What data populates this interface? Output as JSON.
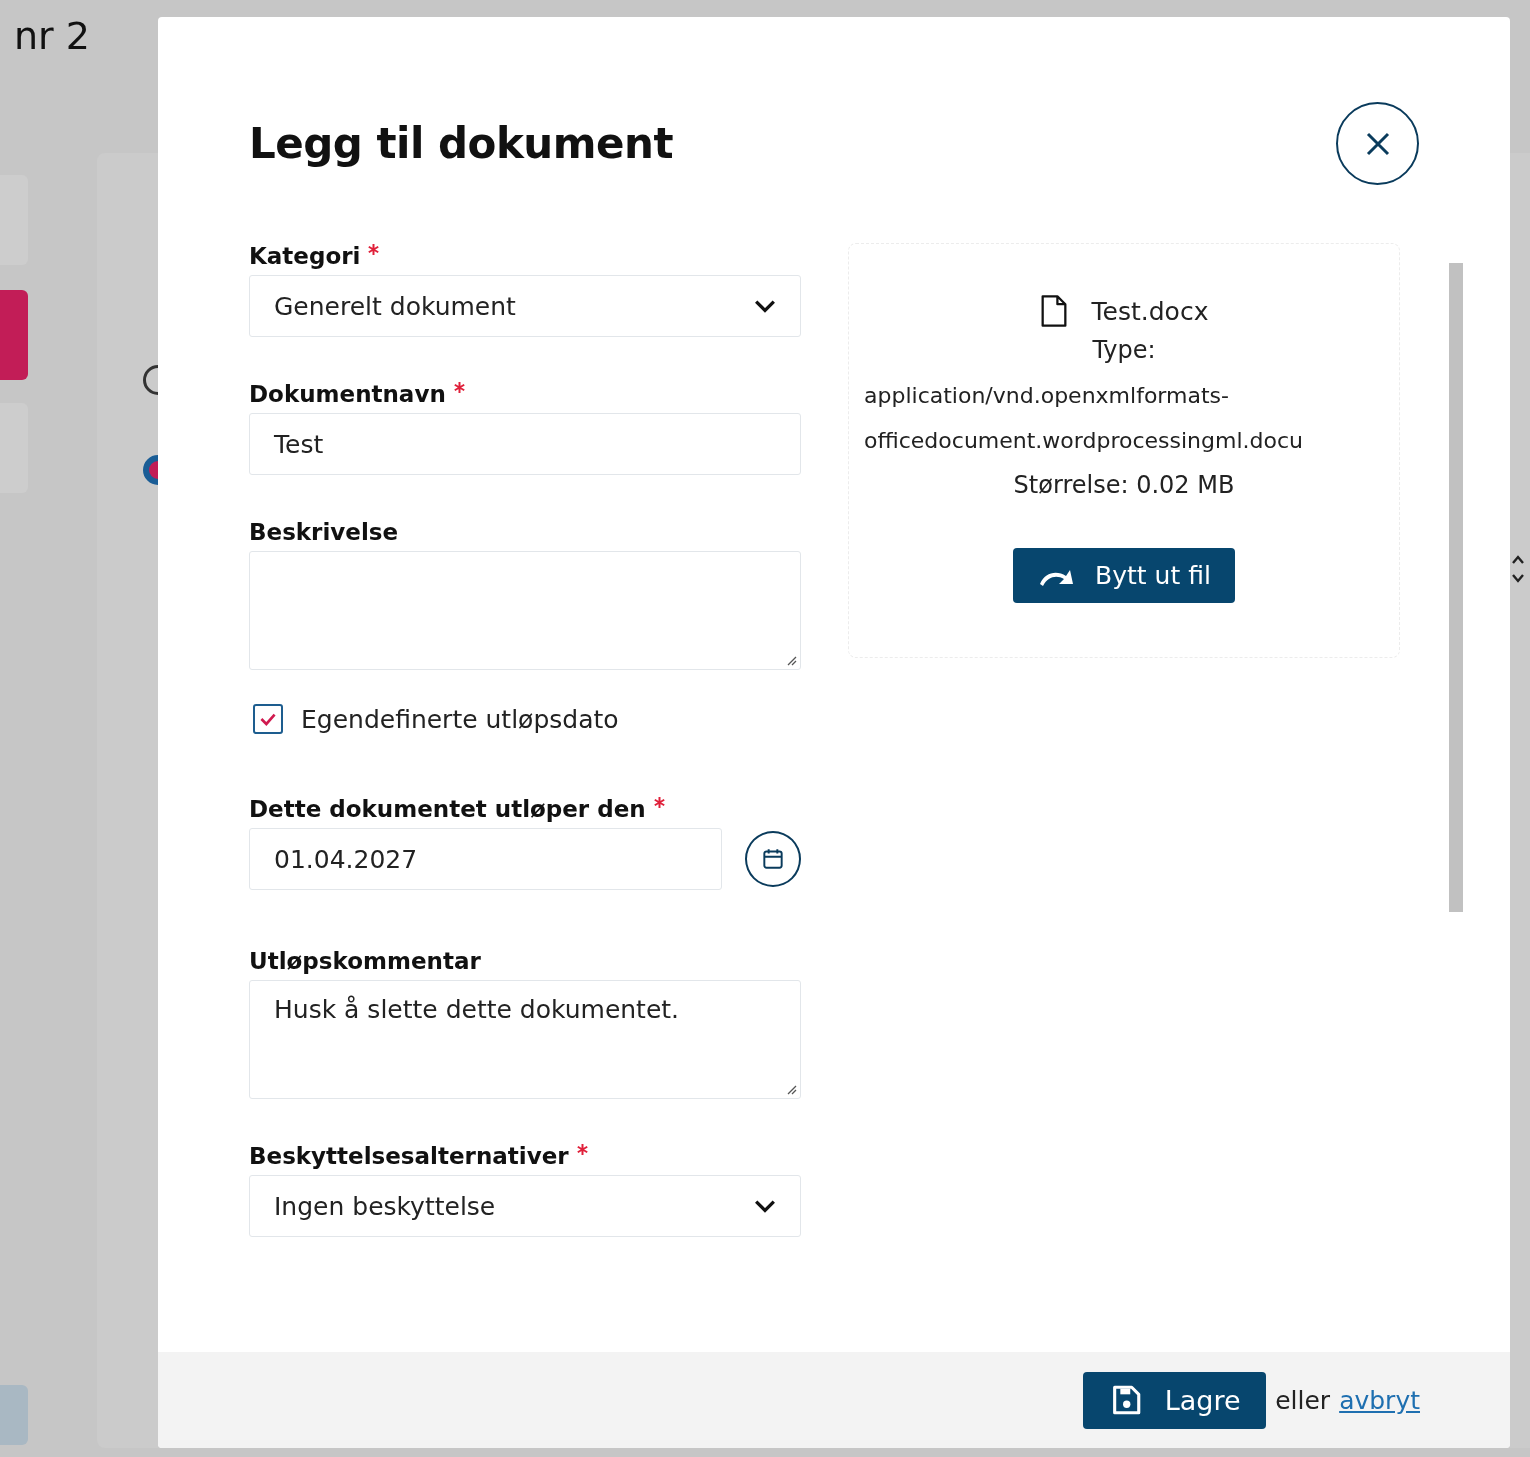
{
  "background": {
    "heading": "nr 2",
    "radios": [
      {
        "selected": false
      },
      {
        "selected": true
      }
    ]
  },
  "dialog": {
    "title": "Legg til dokument",
    "fields": [
      {
        "kind": "select",
        "label": "Kategori",
        "required": true,
        "value": "Generelt dokument"
      },
      {
        "kind": "text",
        "label": "Dokumentnavn",
        "required": true,
        "value": "Test"
      },
      {
        "kind": "textarea",
        "label": "Beskrivelse"
      },
      {
        "kind": "checkbox",
        "label": "Egendefinerte utløpsdato",
        "checked": true
      },
      {
        "kind": "date",
        "label": "Dette dokumentet utløper den",
        "required": true,
        "value": "01.04.2027"
      },
      {
        "kind": "textarea",
        "label": "Utløpskommentar",
        "value": "Husk å slette dette dokumentet."
      },
      {
        "kind": "select",
        "label": "Beskyttelsesalternativer",
        "required": true,
        "value": "Ingen beskyttelse"
      }
    ],
    "file": {
      "name": "Test.docx",
      "type_label": "Type:",
      "type_value": "application/vnd.openxmlformats-officedocument.wordprocessingml.docu",
      "size": "Størrelse: 0.02 MB",
      "replace_button": "Bytt ut fil"
    },
    "footer": {
      "save_button": "Lagre",
      "separator": "eller",
      "cancel_link": "avbryt"
    }
  }
}
